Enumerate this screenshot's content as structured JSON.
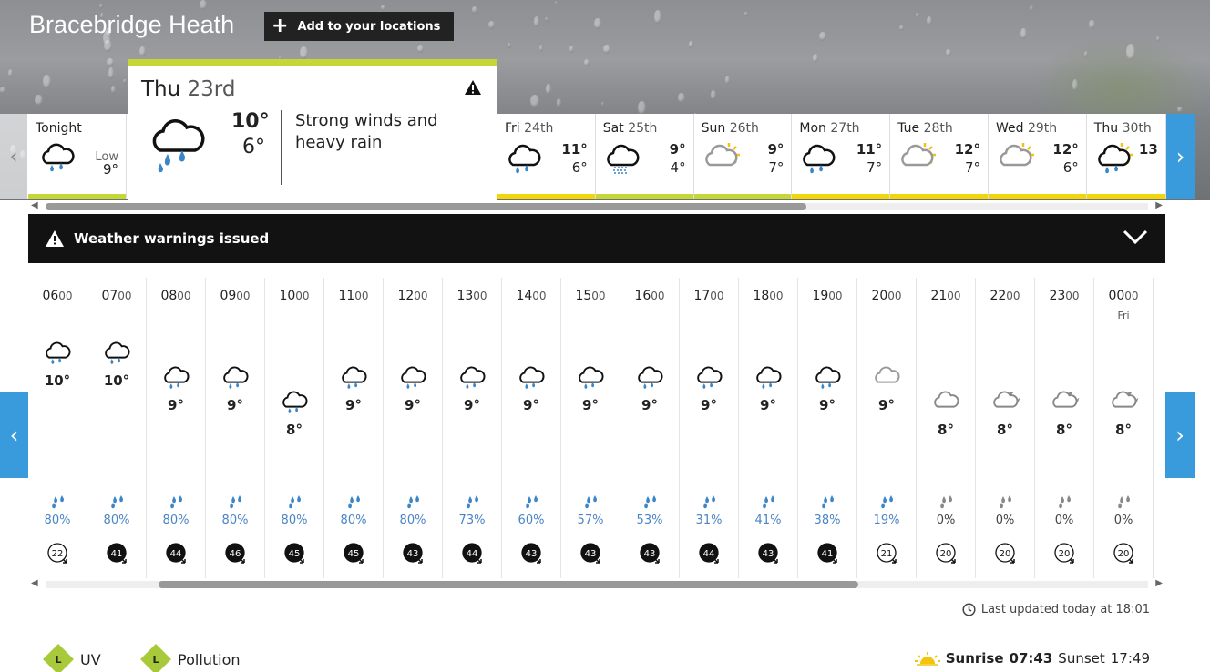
{
  "location": {
    "name": "Bracebridge Heath",
    "add_label": "Add to your locations"
  },
  "tonight": {
    "label": "Tonight",
    "low_label": "Low",
    "low": "9°",
    "icon": "rain-cloud-icon",
    "bar_color": "#c5d638"
  },
  "today": {
    "day": "Thu",
    "date": "23rd",
    "high": "10°",
    "low": "6°",
    "description": "Strong winds and heavy rain",
    "icon": "heavy-rain-cloud-icon",
    "warning_icon": "warning-triangle-icon",
    "bar_color": "#c5d638"
  },
  "days": [
    {
      "day": "Fri",
      "date": "24th",
      "high": "11°",
      "low": "6°",
      "icon": "rain",
      "bar_color": "#f2d60a"
    },
    {
      "day": "Sat",
      "date": "25th",
      "high": "9°",
      "low": "4°",
      "icon": "drizzle",
      "bar_color": "#c5d638"
    },
    {
      "day": "Sun",
      "date": "26th",
      "high": "9°",
      "low": "7°",
      "icon": "sun-cloud",
      "bar_color": "#c5d638"
    },
    {
      "day": "Mon",
      "date": "27th",
      "high": "11°",
      "low": "7°",
      "icon": "rain",
      "bar_color": "#f2d60a"
    },
    {
      "day": "Tue",
      "date": "28th",
      "high": "12°",
      "low": "7°",
      "icon": "sun-cloud",
      "bar_color": "#f2d60a"
    },
    {
      "day": "Wed",
      "date": "29th",
      "high": "12°",
      "low": "6°",
      "icon": "sun-cloud",
      "bar_color": "#f2d60a"
    },
    {
      "day": "Thu",
      "date": "30th",
      "high": "13",
      "low": "",
      "icon": "sun-rain",
      "bar_color": "#f2d60a"
    }
  ],
  "warnings": {
    "label": "Weather warnings issued"
  },
  "hours": [
    {
      "hh": "06",
      "mm": "00",
      "day": "",
      "icon": "rain",
      "temp": "10°",
      "level": 0,
      "rain": "80%",
      "wind": "22",
      "wind_dark": false
    },
    {
      "hh": "07",
      "mm": "00",
      "day": "",
      "icon": "rain",
      "temp": "10°",
      "level": 0,
      "rain": "80%",
      "wind": "41",
      "wind_dark": true
    },
    {
      "hh": "08",
      "mm": "00",
      "day": "",
      "icon": "rain",
      "temp": "9°",
      "level": 1,
      "rain": "80%",
      "wind": "44",
      "wind_dark": true
    },
    {
      "hh": "09",
      "mm": "00",
      "day": "",
      "icon": "rain",
      "temp": "9°",
      "level": 1,
      "rain": "80%",
      "wind": "46",
      "wind_dark": true
    },
    {
      "hh": "10",
      "mm": "00",
      "day": "",
      "icon": "rain",
      "temp": "8°",
      "level": 2,
      "rain": "80%",
      "wind": "45",
      "wind_dark": true
    },
    {
      "hh": "11",
      "mm": "00",
      "day": "",
      "icon": "rain",
      "temp": "9°",
      "level": 1,
      "rain": "80%",
      "wind": "45",
      "wind_dark": true
    },
    {
      "hh": "12",
      "mm": "00",
      "day": "",
      "icon": "rain",
      "temp": "9°",
      "level": 1,
      "rain": "80%",
      "wind": "43",
      "wind_dark": true
    },
    {
      "hh": "13",
      "mm": "00",
      "day": "",
      "icon": "rain",
      "temp": "9°",
      "level": 1,
      "rain": "73%",
      "wind": "44",
      "wind_dark": true
    },
    {
      "hh": "14",
      "mm": "00",
      "day": "",
      "icon": "rain",
      "temp": "9°",
      "level": 1,
      "rain": "60%",
      "wind": "43",
      "wind_dark": true
    },
    {
      "hh": "15",
      "mm": "00",
      "day": "",
      "icon": "rain",
      "temp": "9°",
      "level": 1,
      "rain": "57%",
      "wind": "43",
      "wind_dark": true
    },
    {
      "hh": "16",
      "mm": "00",
      "day": "",
      "icon": "rain",
      "temp": "9°",
      "level": 1,
      "rain": "53%",
      "wind": "43",
      "wind_dark": true
    },
    {
      "hh": "17",
      "mm": "00",
      "day": "",
      "icon": "rain",
      "temp": "9°",
      "level": 1,
      "rain": "31%",
      "wind": "44",
      "wind_dark": true
    },
    {
      "hh": "18",
      "mm": "00",
      "day": "",
      "icon": "rain",
      "temp": "9°",
      "level": 1,
      "rain": "41%",
      "wind": "43",
      "wind_dark": true
    },
    {
      "hh": "19",
      "mm": "00",
      "day": "",
      "icon": "rain",
      "temp": "9°",
      "level": 1,
      "rain": "38%",
      "wind": "41",
      "wind_dark": true
    },
    {
      "hh": "20",
      "mm": "00",
      "day": "",
      "icon": "cloud-light",
      "temp": "9°",
      "level": 1,
      "rain": "19%",
      "wind": "21",
      "wind_dark": false
    },
    {
      "hh": "21",
      "mm": "00",
      "day": "",
      "icon": "cloud",
      "temp": "8°",
      "level": 2,
      "rain": "0%",
      "wind": "20",
      "wind_dark": false
    },
    {
      "hh": "22",
      "mm": "00",
      "day": "",
      "icon": "cloud-moon",
      "temp": "8°",
      "level": 2,
      "rain": "0%",
      "wind": "20",
      "wind_dark": false
    },
    {
      "hh": "23",
      "mm": "00",
      "day": "",
      "icon": "cloud-moon",
      "temp": "8°",
      "level": 2,
      "rain": "0%",
      "wind": "20",
      "wind_dark": false
    },
    {
      "hh": "00",
      "mm": "00",
      "day": "Fri",
      "icon": "cloud-moon",
      "temp": "8°",
      "level": 2,
      "rain": "0%",
      "wind": "20",
      "wind_dark": false
    }
  ],
  "last_updated": "Last updated today at 18:01",
  "uv": {
    "level": "L",
    "label": "UV"
  },
  "pollution": {
    "level": "L",
    "label": "Pollution"
  },
  "sun": {
    "sunrise_label": "Sunrise",
    "sunrise": "07:43",
    "sunset_label": "Sunset",
    "sunset": "17:49"
  },
  "colors": {
    "accent": "#3a9bdc",
    "low_badge": "#a8c93a",
    "rain_text": "#4a84c4"
  }
}
